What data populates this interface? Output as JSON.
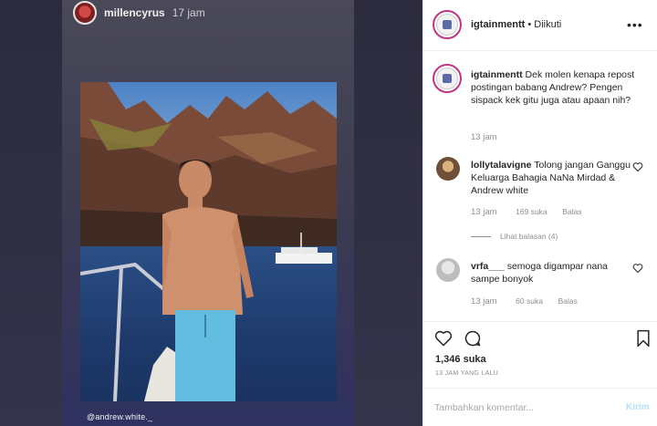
{
  "story": {
    "username": "millencyrus",
    "time": "17 jam",
    "credit": "@andrew.white._"
  },
  "header": {
    "username": "igtainmentt",
    "separator": " • ",
    "follow_status": "Diikuti",
    "more_icon": "more-icon"
  },
  "caption": {
    "username": "igtainmentt",
    "text": "Dek molen kenapa repost postingan babang Andrew? Pengen sispack kek gitu juga atau apaan nih?",
    "time": "13 jam"
  },
  "comments": [
    {
      "username": "lollytalavigne",
      "text": "Tolong jangan Ganggu Keluarga Bahagia NaNa Mirdad & Andrew white",
      "time": "13 jam",
      "likes": "169 suka",
      "reply_label": "Balas",
      "view_replies": "Lihat balasan (4)"
    },
    {
      "username": "vrfa___",
      "text": "semoga digampar nana sampe bonyok",
      "time": "13 jam",
      "likes": "60 suka",
      "reply_label": "Balas"
    }
  ],
  "actions": {
    "likes_count": "1,346 suka",
    "post_time": "13 JAM YANG LALU"
  },
  "add_comment": {
    "placeholder": "Tambahkan komentar...",
    "post_label": "Kirim"
  },
  "colors": {
    "text": "#262626",
    "muted": "#8e8e8e",
    "link_disabled": "#b2dffc",
    "ring": "#c13584"
  }
}
